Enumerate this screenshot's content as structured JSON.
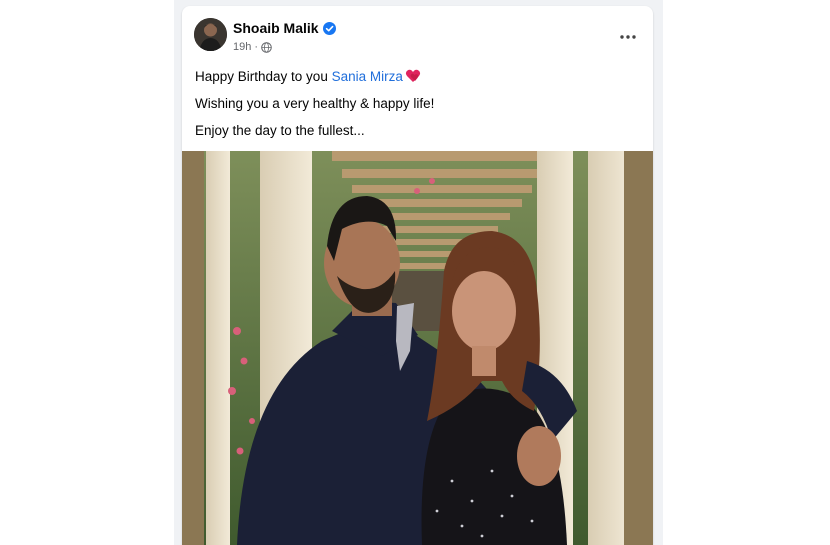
{
  "post": {
    "author": "Shoaib Malik",
    "time": "19h",
    "line1_prefix": "Happy Birthday to you ",
    "mention": "Sania Mirza",
    "line2": "Wishing you a very healthy & happy life!",
    "line3": "Enjoy the day to the fullest..."
  },
  "icons": {
    "verified": "verified-badge-icon",
    "privacy": "globe-icon",
    "more": "more-options-icon",
    "emoji": "heart-emoji-icon"
  },
  "colors": {
    "feed_background": "#f0f2f5",
    "mention_blue": "#216fdb",
    "verified_blue": "#1877f2",
    "secondary_text": "#65676b"
  }
}
